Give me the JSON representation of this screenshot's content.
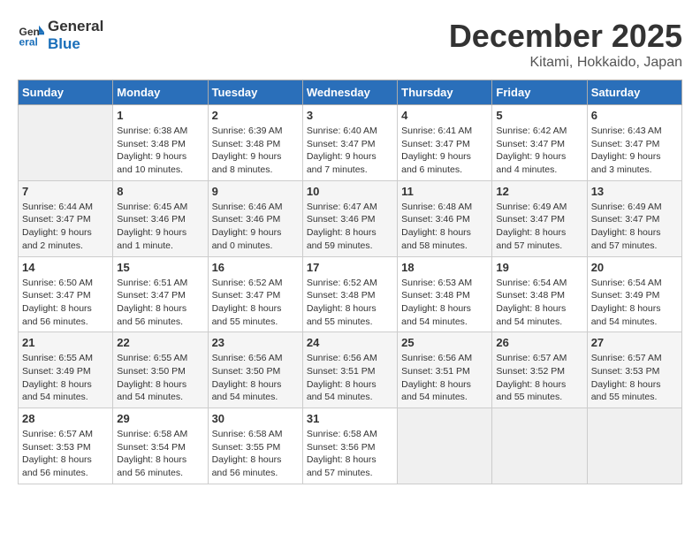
{
  "header": {
    "logo_line1": "General",
    "logo_line2": "Blue",
    "month": "December 2025",
    "location": "Kitami, Hokkaido, Japan"
  },
  "weekdays": [
    "Sunday",
    "Monday",
    "Tuesday",
    "Wednesday",
    "Thursday",
    "Friday",
    "Saturday"
  ],
  "weeks": [
    [
      {
        "day": "",
        "sunrise": "",
        "sunset": "",
        "daylight": ""
      },
      {
        "day": "1",
        "sunrise": "Sunrise: 6:38 AM",
        "sunset": "Sunset: 3:48 PM",
        "daylight": "Daylight: 9 hours and 10 minutes."
      },
      {
        "day": "2",
        "sunrise": "Sunrise: 6:39 AM",
        "sunset": "Sunset: 3:48 PM",
        "daylight": "Daylight: 9 hours and 8 minutes."
      },
      {
        "day": "3",
        "sunrise": "Sunrise: 6:40 AM",
        "sunset": "Sunset: 3:47 PM",
        "daylight": "Daylight: 9 hours and 7 minutes."
      },
      {
        "day": "4",
        "sunrise": "Sunrise: 6:41 AM",
        "sunset": "Sunset: 3:47 PM",
        "daylight": "Daylight: 9 hours and 6 minutes."
      },
      {
        "day": "5",
        "sunrise": "Sunrise: 6:42 AM",
        "sunset": "Sunset: 3:47 PM",
        "daylight": "Daylight: 9 hours and 4 minutes."
      },
      {
        "day": "6",
        "sunrise": "Sunrise: 6:43 AM",
        "sunset": "Sunset: 3:47 PM",
        "daylight": "Daylight: 9 hours and 3 minutes."
      }
    ],
    [
      {
        "day": "7",
        "sunrise": "Sunrise: 6:44 AM",
        "sunset": "Sunset: 3:47 PM",
        "daylight": "Daylight: 9 hours and 2 minutes."
      },
      {
        "day": "8",
        "sunrise": "Sunrise: 6:45 AM",
        "sunset": "Sunset: 3:46 PM",
        "daylight": "Daylight: 9 hours and 1 minute."
      },
      {
        "day": "9",
        "sunrise": "Sunrise: 6:46 AM",
        "sunset": "Sunset: 3:46 PM",
        "daylight": "Daylight: 9 hours and 0 minutes."
      },
      {
        "day": "10",
        "sunrise": "Sunrise: 6:47 AM",
        "sunset": "Sunset: 3:46 PM",
        "daylight": "Daylight: 8 hours and 59 minutes."
      },
      {
        "day": "11",
        "sunrise": "Sunrise: 6:48 AM",
        "sunset": "Sunset: 3:46 PM",
        "daylight": "Daylight: 8 hours and 58 minutes."
      },
      {
        "day": "12",
        "sunrise": "Sunrise: 6:49 AM",
        "sunset": "Sunset: 3:47 PM",
        "daylight": "Daylight: 8 hours and 57 minutes."
      },
      {
        "day": "13",
        "sunrise": "Sunrise: 6:49 AM",
        "sunset": "Sunset: 3:47 PM",
        "daylight": "Daylight: 8 hours and 57 minutes."
      }
    ],
    [
      {
        "day": "14",
        "sunrise": "Sunrise: 6:50 AM",
        "sunset": "Sunset: 3:47 PM",
        "daylight": "Daylight: 8 hours and 56 minutes."
      },
      {
        "day": "15",
        "sunrise": "Sunrise: 6:51 AM",
        "sunset": "Sunset: 3:47 PM",
        "daylight": "Daylight: 8 hours and 56 minutes."
      },
      {
        "day": "16",
        "sunrise": "Sunrise: 6:52 AM",
        "sunset": "Sunset: 3:47 PM",
        "daylight": "Daylight: 8 hours and 55 minutes."
      },
      {
        "day": "17",
        "sunrise": "Sunrise: 6:52 AM",
        "sunset": "Sunset: 3:48 PM",
        "daylight": "Daylight: 8 hours and 55 minutes."
      },
      {
        "day": "18",
        "sunrise": "Sunrise: 6:53 AM",
        "sunset": "Sunset: 3:48 PM",
        "daylight": "Daylight: 8 hours and 54 minutes."
      },
      {
        "day": "19",
        "sunrise": "Sunrise: 6:54 AM",
        "sunset": "Sunset: 3:48 PM",
        "daylight": "Daylight: 8 hours and 54 minutes."
      },
      {
        "day": "20",
        "sunrise": "Sunrise: 6:54 AM",
        "sunset": "Sunset: 3:49 PM",
        "daylight": "Daylight: 8 hours and 54 minutes."
      }
    ],
    [
      {
        "day": "21",
        "sunrise": "Sunrise: 6:55 AM",
        "sunset": "Sunset: 3:49 PM",
        "daylight": "Daylight: 8 hours and 54 minutes."
      },
      {
        "day": "22",
        "sunrise": "Sunrise: 6:55 AM",
        "sunset": "Sunset: 3:50 PM",
        "daylight": "Daylight: 8 hours and 54 minutes."
      },
      {
        "day": "23",
        "sunrise": "Sunrise: 6:56 AM",
        "sunset": "Sunset: 3:50 PM",
        "daylight": "Daylight: 8 hours and 54 minutes."
      },
      {
        "day": "24",
        "sunrise": "Sunrise: 6:56 AM",
        "sunset": "Sunset: 3:51 PM",
        "daylight": "Daylight: 8 hours and 54 minutes."
      },
      {
        "day": "25",
        "sunrise": "Sunrise: 6:56 AM",
        "sunset": "Sunset: 3:51 PM",
        "daylight": "Daylight: 8 hours and 54 minutes."
      },
      {
        "day": "26",
        "sunrise": "Sunrise: 6:57 AM",
        "sunset": "Sunset: 3:52 PM",
        "daylight": "Daylight: 8 hours and 55 minutes."
      },
      {
        "day": "27",
        "sunrise": "Sunrise: 6:57 AM",
        "sunset": "Sunset: 3:53 PM",
        "daylight": "Daylight: 8 hours and 55 minutes."
      }
    ],
    [
      {
        "day": "28",
        "sunrise": "Sunrise: 6:57 AM",
        "sunset": "Sunset: 3:53 PM",
        "daylight": "Daylight: 8 hours and 56 minutes."
      },
      {
        "day": "29",
        "sunrise": "Sunrise: 6:58 AM",
        "sunset": "Sunset: 3:54 PM",
        "daylight": "Daylight: 8 hours and 56 minutes."
      },
      {
        "day": "30",
        "sunrise": "Sunrise: 6:58 AM",
        "sunset": "Sunset: 3:55 PM",
        "daylight": "Daylight: 8 hours and 56 minutes."
      },
      {
        "day": "31",
        "sunrise": "Sunrise: 6:58 AM",
        "sunset": "Sunset: 3:56 PM",
        "daylight": "Daylight: 8 hours and 57 minutes."
      },
      {
        "day": "",
        "sunrise": "",
        "sunset": "",
        "daylight": ""
      },
      {
        "day": "",
        "sunrise": "",
        "sunset": "",
        "daylight": ""
      },
      {
        "day": "",
        "sunrise": "",
        "sunset": "",
        "daylight": ""
      }
    ]
  ]
}
